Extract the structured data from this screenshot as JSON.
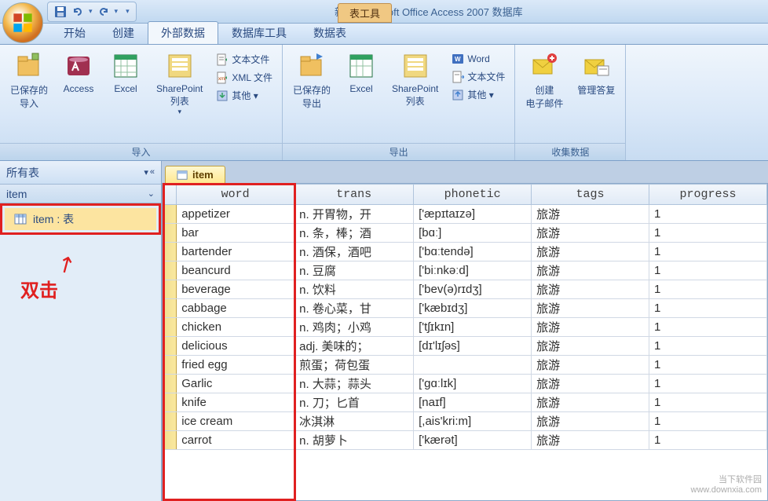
{
  "title": "新建 Microsoft Office Access 2007 数据库",
  "tools_tab": "表工具",
  "tabs": [
    "开始",
    "创建",
    "外部数据",
    "数据库工具",
    "数据表"
  ],
  "active_tab": 2,
  "ribbon": {
    "import": {
      "label": "导入",
      "saved": "已保存的\n导入",
      "access": "Access",
      "excel": "Excel",
      "sharepoint": "SharePoint\n列表",
      "text": "文本文件",
      "xml": "XML 文件",
      "other": "其他 ▾"
    },
    "export": {
      "label": "导出",
      "saved": "已保存的\n导出",
      "excel": "Excel",
      "sharepoint": "SharePoint\n列表",
      "word": "Word",
      "text": "文本文件",
      "other": "其他 ▾"
    },
    "collect": {
      "label": "收集数据",
      "create": "创建\n电子邮件",
      "manage": "管理答复"
    }
  },
  "nav": {
    "header": "所有表",
    "group": "item",
    "item": "item : 表"
  },
  "annotation": "双击",
  "sheet_tab": "item",
  "columns": [
    "word",
    "trans",
    "phonetic",
    "tags",
    "progress"
  ],
  "rows": [
    {
      "word": "appetizer",
      "trans": "n. 开胃物，开",
      "phonetic": "['æpɪtaɪzə]",
      "tags": "旅游",
      "progress": "1"
    },
    {
      "word": "bar",
      "trans": "n. 条，棒；酒",
      "phonetic": "[bɑː]",
      "tags": "旅游",
      "progress": "1"
    },
    {
      "word": "bartender",
      "trans": "n. 酒保，酒吧",
      "phonetic": "['bɑːtendə]",
      "tags": "旅游",
      "progress": "1"
    },
    {
      "word": "beancurd",
      "trans": "n. 豆腐",
      "phonetic": "['biːnkəːd]",
      "tags": "旅游",
      "progress": "1"
    },
    {
      "word": "beverage",
      "trans": "n. 饮料",
      "phonetic": "['bev(ə)rɪdʒ]",
      "tags": "旅游",
      "progress": "1"
    },
    {
      "word": "cabbage",
      "trans": "n. 卷心菜，甘",
      "phonetic": "['kæbɪdʒ]",
      "tags": "旅游",
      "progress": "1"
    },
    {
      "word": "chicken",
      "trans": "n. 鸡肉；小鸡",
      "phonetic": "['tʃɪkɪn]",
      "tags": "旅游",
      "progress": "1"
    },
    {
      "word": "delicious",
      "trans": "adj. 美味的；",
      "phonetic": "[dɪ'lɪʃəs]",
      "tags": "旅游",
      "progress": "1"
    },
    {
      "word": "fried egg",
      "trans": "煎蛋；荷包蛋",
      "phonetic": "",
      "tags": "旅游",
      "progress": "1"
    },
    {
      "word": "Garlic",
      "trans": "n. 大蒜；蒜头",
      "phonetic": "['gɑːlɪk]",
      "tags": "旅游",
      "progress": "1"
    },
    {
      "word": "knife",
      "trans": "n. 刀；匕首",
      "phonetic": "[naɪf]",
      "tags": "旅游",
      "progress": "1"
    },
    {
      "word": "ice cream",
      "trans": "冰淇淋",
      "phonetic": "[,ais'kri:m]",
      "tags": "旅游",
      "progress": "1"
    },
    {
      "word": "carrot",
      "trans": "n. 胡萝卜",
      "phonetic": "['kærət]",
      "tags": "旅游",
      "progress": "1"
    }
  ],
  "watermark": {
    "name": "当下软件园",
    "url": "www.downxia.com"
  }
}
